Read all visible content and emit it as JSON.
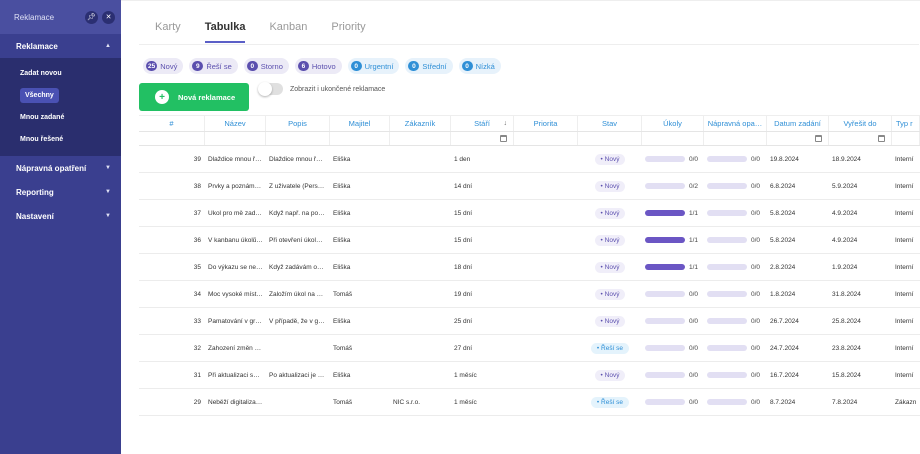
{
  "sidebar": {
    "title": "Reklamace",
    "sections": [
      {
        "label": "Reklamace",
        "expanded": true,
        "items": [
          {
            "label": "Zadat novou",
            "active": false
          },
          {
            "label": "Všechny",
            "active": true
          },
          {
            "label": "Mnou zadané",
            "active": false
          },
          {
            "label": "Mnou řešené",
            "active": false
          }
        ]
      },
      {
        "label": "Nápravná opatření"
      },
      {
        "label": "Reporting"
      },
      {
        "label": "Nastavení"
      }
    ]
  },
  "tabs": [
    "Karty",
    "Tabulka",
    "Kanban",
    "Priority"
  ],
  "active_tab": "Tabulka",
  "chips": [
    {
      "count": "25",
      "label": "Nový",
      "color": "purple"
    },
    {
      "count": "9",
      "label": "Řeší se",
      "color": "purple"
    },
    {
      "count": "0",
      "label": "Storno",
      "color": "purple"
    },
    {
      "count": "6",
      "label": "Hotovo",
      "color": "purple"
    },
    {
      "count": "0",
      "label": "Urgentní",
      "color": "blue"
    },
    {
      "count": "0",
      "label": "Střední",
      "color": "blue"
    },
    {
      "count": "0",
      "label": "Nízká",
      "color": "blue"
    }
  ],
  "new_button": "Nová reklamace",
  "toggle_label": "Zobrazit i ukončené reklamace",
  "columns": [
    "#",
    "Název",
    "Popis",
    "Majitel",
    "Zákazník",
    "Stáří",
    "Priorita",
    "Stav",
    "Úkoly",
    "Nápravná opa…",
    "Datum zadání",
    "Vyřešit do",
    "Typ r"
  ],
  "rows": [
    {
      "id": "39",
      "nazev": "Dlaždice mnou ř…",
      "popis": "Dlaždice mnou ř…",
      "majitel": "Eliška",
      "zakaznik": "",
      "stari": "1 den",
      "priorita": "",
      "stav": "Nový",
      "ukoly_done": 0,
      "ukoly_total": 0,
      "ukoly": "0/0",
      "naprava": "0/0",
      "datum": "19.8.2024",
      "vyresit": "18.9.2024",
      "typ": "Interní"
    },
    {
      "id": "38",
      "nazev": "Prvky a poznámk…",
      "popis": "Z uživatele (Pers…",
      "majitel": "Eliška",
      "zakaznik": "",
      "stari": "14 dní",
      "priorita": "",
      "stav": "Nový",
      "ukoly_done": 0,
      "ukoly_total": 2,
      "ukoly": "0/2",
      "naprava": "0/0",
      "datum": "6.8.2024",
      "vyresit": "5.9.2024",
      "typ": "Interní"
    },
    {
      "id": "37",
      "nazev": "Úkol pro mě zad…",
      "popis": "Když např. na po…",
      "majitel": "Eliška",
      "zakaznik": "",
      "stari": "15 dní",
      "priorita": "",
      "stav": "Nový",
      "ukoly_done": 1,
      "ukoly_total": 1,
      "ukoly": "1/1",
      "naprava": "0/0",
      "datum": "5.8.2024",
      "vyresit": "4.9.2024",
      "typ": "Interní"
    },
    {
      "id": "36",
      "nazev": "V kanbanu úkolů…",
      "popis": "Při otevření úkol…",
      "majitel": "Eliška",
      "zakaznik": "",
      "stari": "15 dní",
      "priorita": "",
      "stav": "Nový",
      "ukoly_done": 1,
      "ukoly_total": 1,
      "ukoly": "1/1",
      "naprava": "0/0",
      "datum": "5.8.2024",
      "vyresit": "4.9.2024",
      "typ": "Interní"
    },
    {
      "id": "35",
      "nazev": "Do výkazu se ne…",
      "popis": "Když zadávám o…",
      "majitel": "Eliška",
      "zakaznik": "",
      "stari": "18 dní",
      "priorita": "",
      "stav": "Nový",
      "ukoly_done": 1,
      "ukoly_total": 1,
      "ukoly": "1/1",
      "naprava": "0/0",
      "datum": "2.8.2024",
      "vyresit": "1.9.2024",
      "typ": "Interní"
    },
    {
      "id": "34",
      "nazev": "Moc vysoké míst…",
      "popis": "Založím úkol na …",
      "majitel": "Tomáš",
      "zakaznik": "",
      "stari": "19 dní",
      "priorita": "",
      "stav": "Nový",
      "ukoly_done": 0,
      "ukoly_total": 0,
      "ukoly": "0/0",
      "naprava": "0/0",
      "datum": "1.8.2024",
      "vyresit": "31.8.2024",
      "typ": "Interní"
    },
    {
      "id": "33",
      "nazev": "Pamatování v gri…",
      "popis": "V případě, že v g…",
      "majitel": "Eliška",
      "zakaznik": "",
      "stari": "25 dní",
      "priorita": "",
      "stav": "Nový",
      "ukoly_done": 0,
      "ukoly_total": 0,
      "ukoly": "0/0",
      "naprava": "0/0",
      "datum": "26.7.2024",
      "vyresit": "25.8.2024",
      "typ": "Interní"
    },
    {
      "id": "32",
      "nazev": "Zahození změn u…",
      "popis": "",
      "majitel": "Tomáš",
      "zakaznik": "",
      "stari": "27 dní",
      "priorita": "",
      "stav": "Řeší se",
      "ukoly_done": 0,
      "ukoly_total": 0,
      "ukoly": "0/0",
      "naprava": "0/0",
      "datum": "24.7.2024",
      "vyresit": "23.8.2024",
      "typ": "Interní"
    },
    {
      "id": "31",
      "nazev": "Při aktualizaci se…",
      "popis": "Po aktualizaci je …",
      "majitel": "Eliška",
      "zakaznik": "",
      "stari": "1 měsíc",
      "priorita": "",
      "stav": "Nový",
      "ukoly_done": 0,
      "ukoly_total": 0,
      "ukoly": "0/0",
      "naprava": "0/0",
      "datum": "16.7.2024",
      "vyresit": "15.8.2024",
      "typ": "Interní"
    },
    {
      "id": "29",
      "nazev": "Neběží digitaliza…",
      "popis": "",
      "majitel": "Tomáš",
      "zakaznik": "NIC         s.r.o.",
      "stari": "1 měsíc",
      "priorita": "",
      "stav": "Řeší se",
      "ukoly_done": 0,
      "ukoly_total": 0,
      "ukoly": "0/0",
      "naprava": "0/0",
      "datum": "8.7.2024",
      "vyresit": "7.8.2024",
      "typ": "Zákazn"
    }
  ]
}
